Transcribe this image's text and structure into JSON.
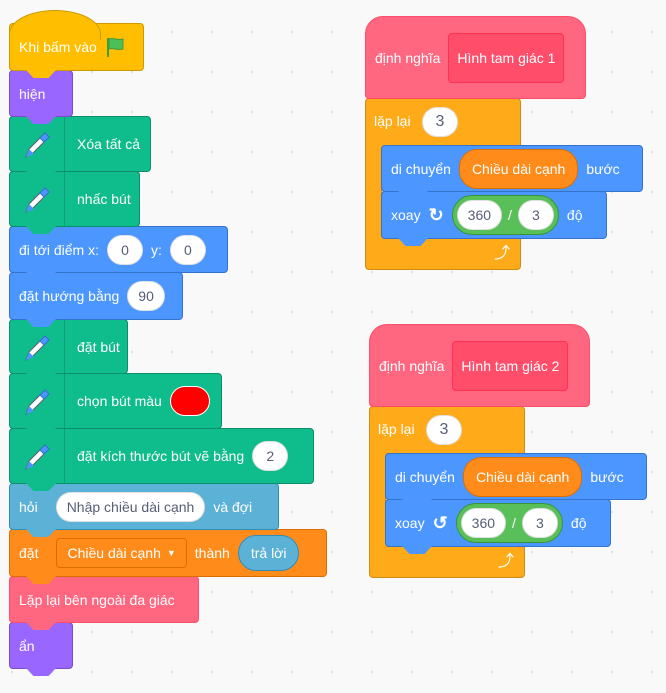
{
  "main_script": {
    "when_flag": {
      "label": "Khi bấm vào",
      "icon": "green-flag-icon"
    },
    "show": {
      "label": "hiện"
    },
    "clear": {
      "label": "Xóa tất cả",
      "icon": "pen-icon"
    },
    "pen_up": {
      "label": "nhấc bút",
      "icon": "pen-icon"
    },
    "goto": {
      "label": "đi tới điểm x:",
      "x": "0",
      "y_label": "y:",
      "y": "0"
    },
    "point": {
      "label": "đặt hướng bằng",
      "value": "90"
    },
    "pen_down": {
      "label": "đặt bút",
      "icon": "pen-icon"
    },
    "pen_color": {
      "label": "chọn bút màu",
      "color": "#FF0000",
      "icon": "pen-icon"
    },
    "pen_size": {
      "label": "đặt kích thước bút vẽ bằng",
      "value": "2",
      "icon": "pen-icon"
    },
    "ask": {
      "label": "hỏi",
      "question": "Nhập chiều dài cạnh",
      "suffix": "và đợi"
    },
    "set_var": {
      "label": "đặt",
      "variable": "Chiều dài cạnh",
      "to": "thành",
      "value": "trả lời"
    },
    "call": {
      "label": "Lặp lại bên ngoài đa giác"
    },
    "hide": {
      "label": "ẩn"
    }
  },
  "procedures": [
    {
      "define": "định nghĩa",
      "name": "Hình tam giác 1",
      "repeat": "lặp lại",
      "times": "3",
      "move": "di chuyển",
      "move_var": "Chiều dài cạnh",
      "steps": "bước",
      "turn": "xoay",
      "turn_icon": "rotate-right-icon",
      "num": "360",
      "op": "/",
      "den": "3",
      "deg": "độ"
    },
    {
      "define": "định nghĩa",
      "name": "Hình tam giác 2",
      "repeat": "lặp lại",
      "times": "3",
      "move": "di chuyển",
      "move_var": "Chiều dài cạnh",
      "steps": "bước",
      "turn": "xoay",
      "turn_icon": "rotate-left-icon",
      "num": "360",
      "op": "/",
      "den": "3",
      "deg": "độ"
    }
  ]
}
